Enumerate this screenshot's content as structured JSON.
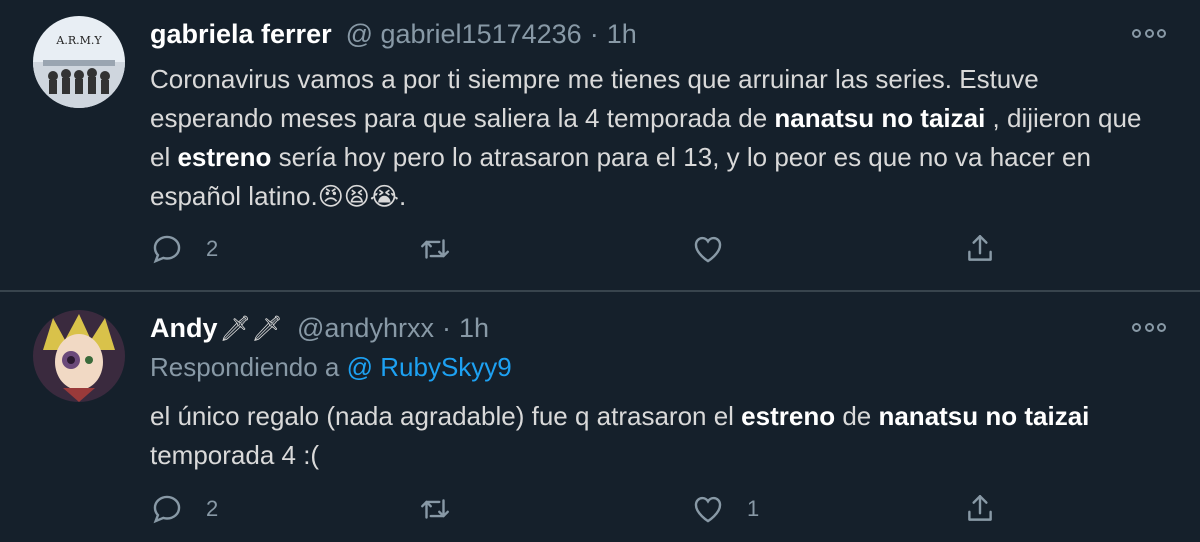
{
  "tweets": [
    {
      "display_name": "gabriela ferrer",
      "handle": "@ gabriel15174236",
      "separator": "·",
      "time": "1h",
      "avatar_text": "A.R.M.Y",
      "body": {
        "t1": "Coronavirus vamos a por ti siempre me tienes que arruinar las series. Estuve esperando meses para que saliera la 4 temporada de ",
        "b1": "nanatsu no taizai",
        "t2": " , dijieron que el ",
        "b2": "estreno",
        "t3": " sería hoy pero lo atrasaron para el 13, y lo peor es que no va hacer en español latino.",
        "emojis": "😠😫😭",
        "t4": "."
      },
      "replies": "2",
      "retweets": "",
      "likes": ""
    },
    {
      "display_name": "Andy",
      "name_emojis": "🗡🗡",
      "handle": "@andyhrxx",
      "separator": "·",
      "time": "1h",
      "replying_prefix": "Respondiendo a",
      "replying_to": "@ RubySkyy9",
      "body": {
        "t1": "el único regalo (nada agradable) fue q atrasaron el ",
        "b1": "estreno",
        "t2": " de ",
        "b2": "nanatsu no taizai",
        "t3": " temporada 4 :("
      },
      "replies": "2",
      "retweets": "",
      "likes": "1"
    }
  ],
  "colors": {
    "background": "#15202b",
    "divider": "#38444d",
    "secondary_text": "#8899a6",
    "link": "#1da1f2"
  }
}
